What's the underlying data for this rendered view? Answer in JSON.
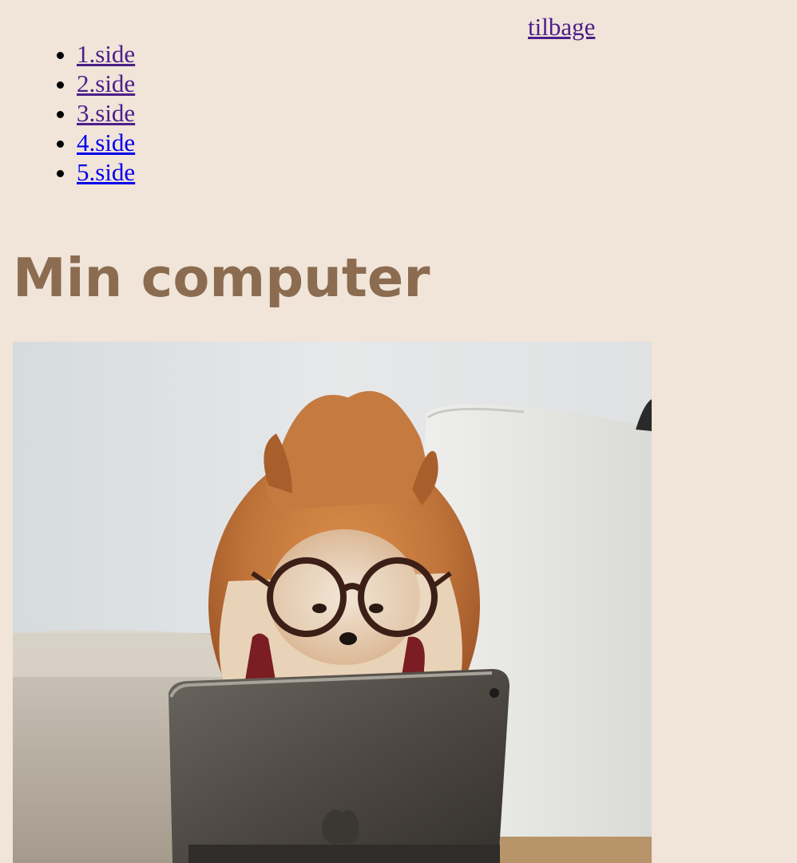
{
  "header": {
    "back_link": "tilbage"
  },
  "nav": {
    "items": [
      {
        "label": "1.side"
      },
      {
        "label": "2.side"
      },
      {
        "label": "3.side"
      },
      {
        "label": "4.side"
      },
      {
        "label": "5.side"
      }
    ]
  },
  "main": {
    "title": "Min computer"
  },
  "colors": {
    "background": "#f1e4d8",
    "title": "#8b6c50",
    "visited_link": "#4b1f8a",
    "unvisited_link": "#0000ee"
  }
}
